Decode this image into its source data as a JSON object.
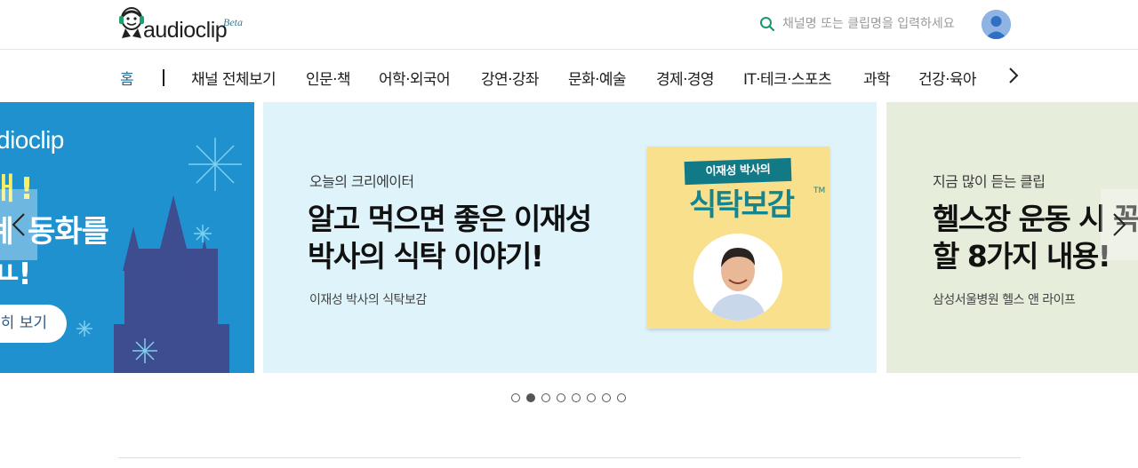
{
  "header": {
    "logo_text": "audioclip",
    "logo_beta": "Beta",
    "search": {
      "placeholder": "채널명 또는 클립명을 입력하세요"
    }
  },
  "nav": {
    "items": [
      {
        "label": "홈",
        "active": true
      },
      {
        "label": "채널 전체보기"
      },
      {
        "label": "인문·책"
      },
      {
        "label": "어학·외국어"
      },
      {
        "label": "강연·강좌"
      },
      {
        "label": "문화·예술"
      },
      {
        "label": "경제·경영"
      },
      {
        "label": "IT·테크·스포츠"
      },
      {
        "label": "과학"
      },
      {
        "label": "건강·육아"
      }
    ]
  },
  "carousel": {
    "left": {
      "brand": "dioclip",
      "line1": "ㅐ!",
      "line2": "ㅖ 동화를",
      "line3": "ㅛ!",
      "cta": "히 보기"
    },
    "center": {
      "eyebrow": "오늘의 크리에이터",
      "title_line1": "알고 먹으면 좋은 이재성",
      "title_line2": "박사의 식탁 이야기!",
      "subtitle": "이재성 박사의 식탁보감",
      "cover_tag": "이재성 박사의",
      "cover_title": "식탁보감",
      "cover_tm": "TM"
    },
    "right": {
      "eyebrow": "지금 많이 듣는 클립",
      "title_line1": "헬스장 운동 시 꼭",
      "title_line2": "할 8가지 내용!",
      "subtitle": "삼성서울병원 헬스 앤 라이프"
    },
    "total_slides": 8,
    "active_slide": 2
  },
  "colors": {
    "nav_active": "#2c6b8e",
    "left_slide_bg": "#1f91cf",
    "center_slide_bg": "#dff4fa",
    "right_slide_bg": "#e6edda",
    "cover_bg": "#f9e08d",
    "cover_accent": "#14848f",
    "search_icon": "#1a9a6a"
  }
}
